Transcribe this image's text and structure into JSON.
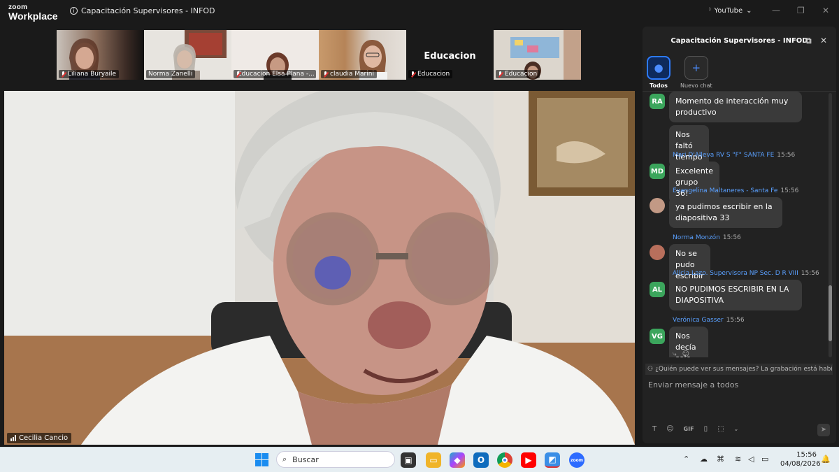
{
  "app": {
    "logo_top": "zoom",
    "logo_bottom": "Workplace",
    "meeting_title": "Capacitación Supervisores - INFOD",
    "share_source": "YouTube"
  },
  "participants": [
    {
      "name": "Liliana Buryaile"
    },
    {
      "name": "Norma Zanelli"
    },
    {
      "name": "Educacion Elsa Plana -..."
    },
    {
      "name": "claudia Marini"
    },
    {
      "name": "Educacion",
      "title": "Educacion"
    },
    {
      "name": "Educacion"
    }
  ],
  "speaker": {
    "name": "Cecilia Cancio"
  },
  "chat": {
    "title": "Capacitación Supervisores - INFOD",
    "tabs": [
      {
        "label": "Todos"
      },
      {
        "label": "Nuevo chat"
      }
    ],
    "messages": [
      {
        "initials": "RA",
        "text": "Momento de interacción muy productivo"
      },
      {
        "text": "Nos faltó tiempo"
      },
      {
        "initials": "MD",
        "sender": "Mari D'Alleva RV S \"F\" SANTA FE",
        "time": "15:56",
        "text": "Excelente grupo 36!"
      },
      {
        "sender": "Evangelina Maltaneres - Santa Fe",
        "time": "15:56",
        "text": "ya pudimos escribir en la diapositiva 33"
      },
      {
        "sender": "Norma Monzón",
        "time": "15:56",
        "text": "No se pudo escribir en la diapo"
      },
      {
        "initials": "AL",
        "sender": "Alicia Lazo. Supervisora NP Sec. D R VIII",
        "time": "15:56",
        "text": "NO PUDIMOS ESCRIBIR EN LA DIAPOSITIVA"
      },
      {
        "initials": "VG",
        "sender": "Verónica Gasser",
        "time": "15:56",
        "text": "Nos decía solo lectura"
      }
    ],
    "notice": "¿Quién puede ver sus mensajes? La grabación está habilitada",
    "input_placeholder": "Enviar mensaje a todos",
    "toolbar": {
      "gif": "GIF"
    }
  },
  "taskbar": {
    "search_placeholder": "Buscar",
    "time": "15:56",
    "date": "04/08/2026"
  },
  "colors": {
    "accent": "#2d7bff",
    "avatar_green": "#3ba55c",
    "sender_blue": "#5aa0ff"
  }
}
